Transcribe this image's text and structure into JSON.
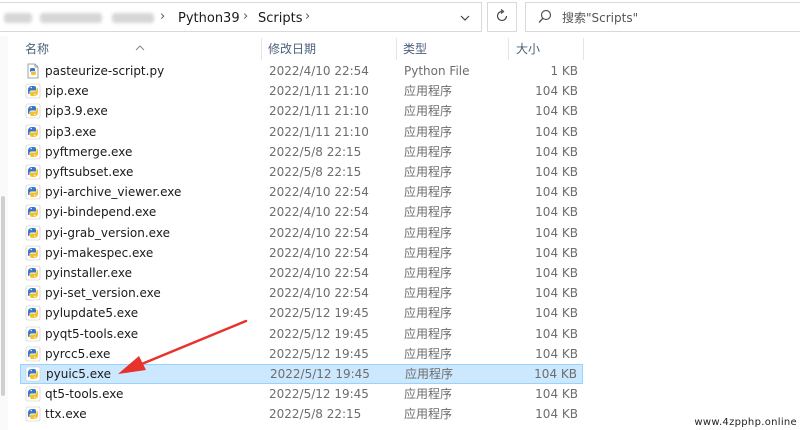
{
  "address_bar": {
    "path": [
      "Python39",
      "Scripts"
    ],
    "dropdown_icon": "chevron-down-icon",
    "refresh_icon": "refresh-icon"
  },
  "search": {
    "placeholder": "搜索\"Scripts\"",
    "icon": "search-icon"
  },
  "columns": {
    "name": "名称",
    "date": "修改日期",
    "type": "类型",
    "size": "大小",
    "sorted_by": "name"
  },
  "files": [
    {
      "name": "pasteurize-script.py",
      "date": "2022/4/10 22:54",
      "type": "Python File",
      "size": "1 KB",
      "icon": "python-script-icon"
    },
    {
      "name": "pip.exe",
      "date": "2022/1/11 21:10",
      "type": "应用程序",
      "size": "104 KB",
      "icon": "python-exe-icon"
    },
    {
      "name": "pip3.9.exe",
      "date": "2022/1/11 21:10",
      "type": "应用程序",
      "size": "104 KB",
      "icon": "python-exe-icon"
    },
    {
      "name": "pip3.exe",
      "date": "2022/1/11 21:10",
      "type": "应用程序",
      "size": "104 KB",
      "icon": "python-exe-icon"
    },
    {
      "name": "pyftmerge.exe",
      "date": "2022/5/8 22:15",
      "type": "应用程序",
      "size": "104 KB",
      "icon": "python-exe-icon"
    },
    {
      "name": "pyftsubset.exe",
      "date": "2022/5/8 22:15",
      "type": "应用程序",
      "size": "104 KB",
      "icon": "python-exe-icon"
    },
    {
      "name": "pyi-archive_viewer.exe",
      "date": "2022/4/10 22:54",
      "type": "应用程序",
      "size": "104 KB",
      "icon": "python-exe-icon"
    },
    {
      "name": "pyi-bindepend.exe",
      "date": "2022/4/10 22:54",
      "type": "应用程序",
      "size": "104 KB",
      "icon": "python-exe-icon"
    },
    {
      "name": "pyi-grab_version.exe",
      "date": "2022/4/10 22:54",
      "type": "应用程序",
      "size": "104 KB",
      "icon": "python-exe-icon"
    },
    {
      "name": "pyi-makespec.exe",
      "date": "2022/4/10 22:54",
      "type": "应用程序",
      "size": "104 KB",
      "icon": "python-exe-icon"
    },
    {
      "name": "pyinstaller.exe",
      "date": "2022/4/10 22:54",
      "type": "应用程序",
      "size": "104 KB",
      "icon": "python-exe-icon"
    },
    {
      "name": "pyi-set_version.exe",
      "date": "2022/4/10 22:54",
      "type": "应用程序",
      "size": "104 KB",
      "icon": "python-exe-icon"
    },
    {
      "name": "pylupdate5.exe",
      "date": "2022/5/12 19:45",
      "type": "应用程序",
      "size": "104 KB",
      "icon": "python-exe-icon"
    },
    {
      "name": "pyqt5-tools.exe",
      "date": "2022/5/12 19:45",
      "type": "应用程序",
      "size": "104 KB",
      "icon": "python-exe-icon"
    },
    {
      "name": "pyrcc5.exe",
      "date": "2022/5/12 19:45",
      "type": "应用程序",
      "size": "104 KB",
      "icon": "python-exe-icon"
    },
    {
      "name": "pyuic5.exe",
      "date": "2022/5/12 19:45",
      "type": "应用程序",
      "size": "104 KB",
      "icon": "python-exe-icon",
      "selected": true
    },
    {
      "name": "qt5-tools.exe",
      "date": "2022/5/12 19:45",
      "type": "应用程序",
      "size": "104 KB",
      "icon": "python-exe-icon"
    },
    {
      "name": "ttx.exe",
      "date": "2022/5/8 22:15",
      "type": "应用程序",
      "size": "104 KB",
      "icon": "python-exe-icon"
    }
  ],
  "annotation": {
    "icon": "red-arrow-icon",
    "color": "#e8322c"
  },
  "watermark": "www.4zpphp.online",
  "colors": {
    "selection_bg": "#cce8ff",
    "selection_border": "#99d1ff",
    "header_text": "#4c607a"
  }
}
